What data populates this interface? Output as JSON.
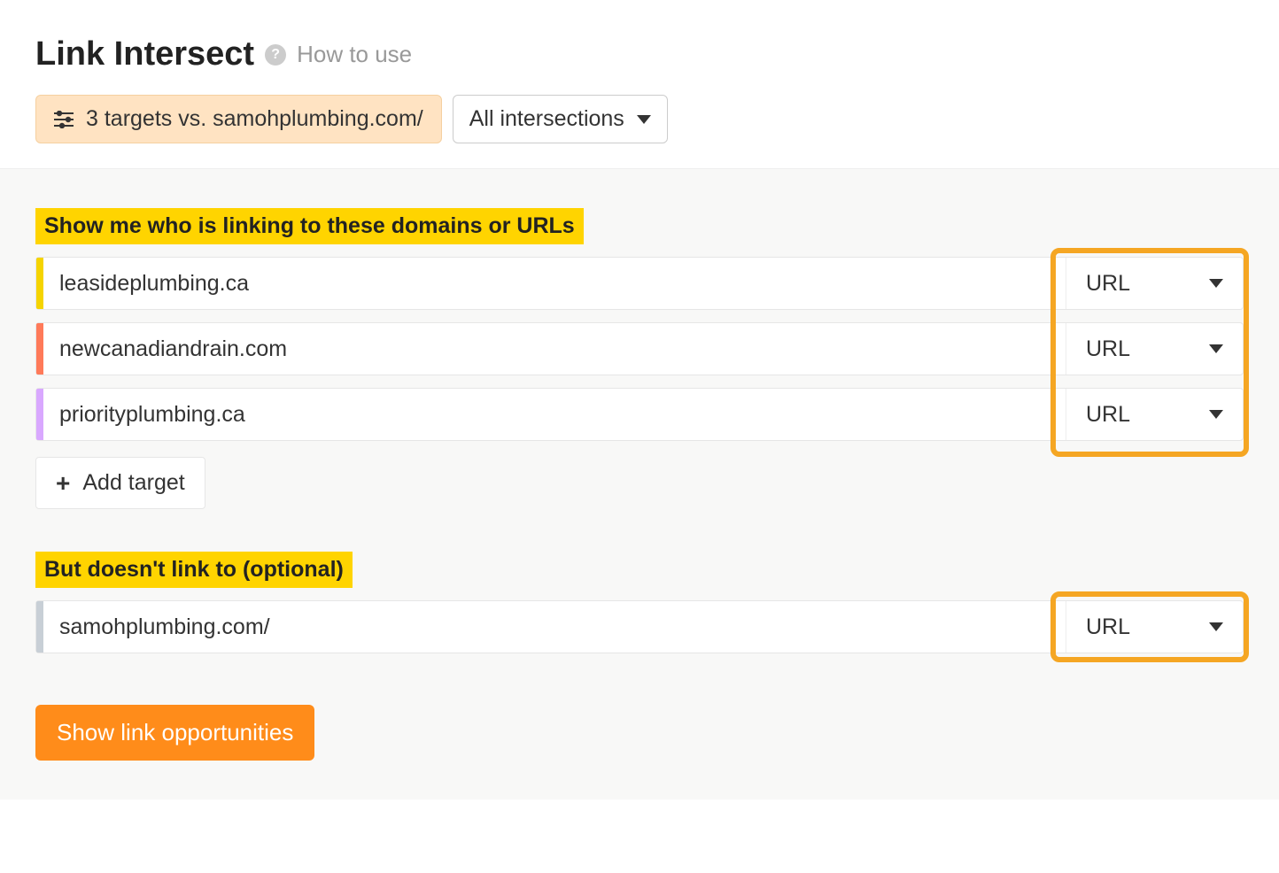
{
  "header": {
    "title": "Link Intersect",
    "how_to_use": "How to use",
    "targets_summary": "3 targets vs. samohplumbing.com/",
    "intersections_label": "All intersections"
  },
  "section1": {
    "label": "Show me who is linking to these domains or URLs",
    "targets": [
      {
        "value": "leasideplumbing.ca",
        "mode": "URL",
        "color": "#f5d400"
      },
      {
        "value": "newcanadiandrain.com",
        "mode": "URL",
        "color": "#ff7a59"
      },
      {
        "value": "priorityplumbing.ca",
        "mode": "URL",
        "color": "#d9a8ff"
      }
    ],
    "add_target_label": "Add target"
  },
  "section2": {
    "label": "But doesn't link to (optional)",
    "target": {
      "value": "samohplumbing.com/",
      "mode": "URL",
      "color": "#c8cfd6"
    }
  },
  "submit_label": "Show link opportunities"
}
